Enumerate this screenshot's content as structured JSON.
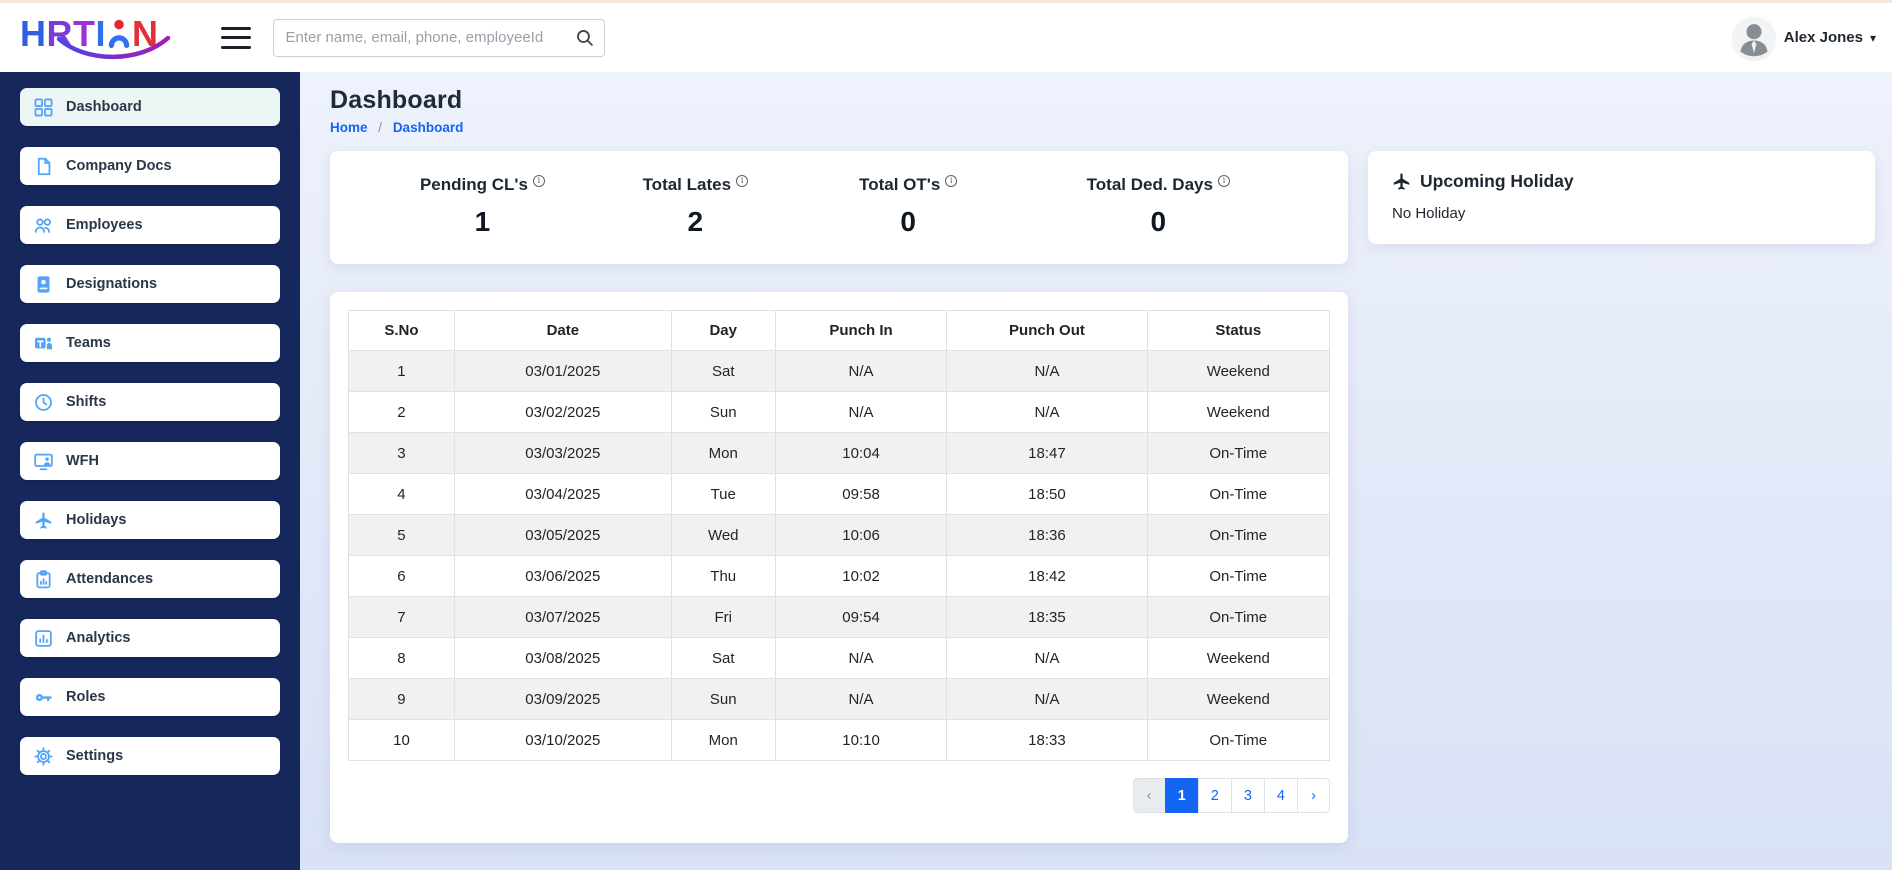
{
  "topbar": {
    "logo": {
      "letters": [
        "H",
        "R",
        "T",
        "I"
      ],
      "last_letter": "N"
    },
    "search": {
      "placeholder": "Enter name, email, phone, employeeId"
    },
    "user": {
      "name": "Alex Jones"
    }
  },
  "sidebar": {
    "items": [
      {
        "label": "Dashboard",
        "icon": "grid-icon",
        "active": true
      },
      {
        "label": "Company Docs",
        "icon": "document-icon",
        "active": false
      },
      {
        "label": "Employees",
        "icon": "users-icon",
        "active": false
      },
      {
        "label": "Designations",
        "icon": "badge-icon",
        "active": false
      },
      {
        "label": "Teams",
        "icon": "teams-icon",
        "active": false
      },
      {
        "label": "Shifts",
        "icon": "clock-icon",
        "active": false
      },
      {
        "label": "WFH",
        "icon": "monitor-user-icon",
        "active": false
      },
      {
        "label": "Holidays",
        "icon": "plane-icon",
        "active": false
      },
      {
        "label": "Attendances",
        "icon": "clipboard-chart-icon",
        "active": false
      },
      {
        "label": "Analytics",
        "icon": "bar-chart-icon",
        "active": false
      },
      {
        "label": "Roles",
        "icon": "key-icon",
        "active": false
      },
      {
        "label": "Settings",
        "icon": "gear-icon",
        "active": false
      }
    ]
  },
  "page": {
    "title": "Dashboard",
    "breadcrumb": {
      "home": "Home",
      "separator": "/",
      "current": "Dashboard"
    }
  },
  "stats": [
    {
      "label": "Pending CL's",
      "value": "1"
    },
    {
      "label": "Total Lates",
      "value": "2"
    },
    {
      "label": "Total OT's",
      "value": "0"
    },
    {
      "label": "Total Ded. Days",
      "value": "0"
    }
  ],
  "holiday_card": {
    "icon": "plane-icon",
    "title": "Upcoming Holiday",
    "message": "No Holiday"
  },
  "attendance_table": {
    "columns": [
      "S.No",
      "Date",
      "Day",
      "Punch In",
      "Punch Out",
      "Status"
    ],
    "rows": [
      [
        "1",
        "03/01/2025",
        "Sat",
        "N/A",
        "N/A",
        "Weekend"
      ],
      [
        "2",
        "03/02/2025",
        "Sun",
        "N/A",
        "N/A",
        "Weekend"
      ],
      [
        "3",
        "03/03/2025",
        "Mon",
        "10:04",
        "18:47",
        "On-Time"
      ],
      [
        "4",
        "03/04/2025",
        "Tue",
        "09:58",
        "18:50",
        "On-Time"
      ],
      [
        "5",
        "03/05/2025",
        "Wed",
        "10:06",
        "18:36",
        "On-Time"
      ],
      [
        "6",
        "03/06/2025",
        "Thu",
        "10:02",
        "18:42",
        "On-Time"
      ],
      [
        "7",
        "03/07/2025",
        "Fri",
        "09:54",
        "18:35",
        "On-Time"
      ],
      [
        "8",
        "03/08/2025",
        "Sat",
        "N/A",
        "N/A",
        "Weekend"
      ],
      [
        "9",
        "03/09/2025",
        "Sun",
        "N/A",
        "N/A",
        "Weekend"
      ],
      [
        "10",
        "03/10/2025",
        "Mon",
        "10:10",
        "18:33",
        "On-Time"
      ]
    ]
  },
  "pagination": {
    "prev_label": "‹",
    "pages": [
      "1",
      "2",
      "3",
      "4"
    ],
    "active": "1",
    "next_label": "›"
  },
  "colors": {
    "accent": "#1266f1",
    "sidebar_bg": "#16275c",
    "sidebar_icon": "#55a3f7",
    "active_item_bg": "#ecf7f5",
    "table_stripe": "#f1f1f1",
    "topbar_strip": "#f6e8d9",
    "logo_blue": "#2f5fe3",
    "logo_purple": "#9c32d4",
    "logo_red": "#e23136"
  }
}
